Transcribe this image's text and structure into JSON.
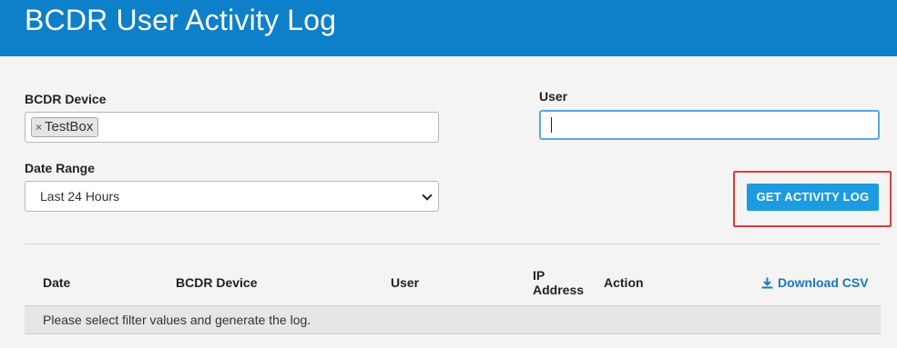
{
  "header": {
    "title": "BCDR User Activity Log"
  },
  "filters": {
    "device_label": "BCDR Device",
    "device_chips": [
      {
        "label": "TestBox",
        "remove_glyph": "×"
      }
    ],
    "user_label": "User",
    "user_value": "",
    "date_label": "Date Range",
    "date_selected": "Last 24 Hours"
  },
  "actions": {
    "get_log_label": "GET ACTIVITY LOG"
  },
  "table": {
    "columns": [
      "Date",
      "BCDR Device",
      "User",
      "IP Address",
      "Action"
    ],
    "ip_lines": [
      "IP",
      "Address"
    ],
    "download_label": "Download CSV",
    "download_icon": "download-icon",
    "empty_message": "Please select filter values and generate the log."
  },
  "colors": {
    "header_bg": "#0e7fc9",
    "button_bg": "#1d9be0",
    "link": "#1a78bf",
    "highlight": "#e03b3b",
    "focus": "#5aa8e8"
  }
}
